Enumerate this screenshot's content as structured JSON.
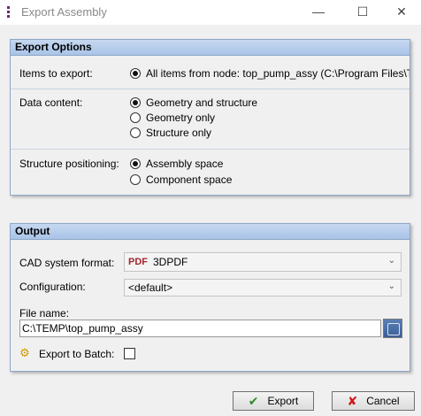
{
  "window": {
    "title": "Export Assembly",
    "minimize_glyph": "—",
    "maximize_glyph": "☐",
    "close_glyph": "✕"
  },
  "export_options": {
    "header": "Export Options",
    "items_to_export": {
      "label": "Items to export:",
      "option": "All items from node: top_pump_assy (C:\\Program Files\\T"
    },
    "data_content": {
      "label": "Data content:",
      "options": [
        "Geometry and structure",
        "Geometry only",
        "Structure only"
      ],
      "selected": "Geometry and structure"
    },
    "structure_positioning": {
      "label": "Structure positioning:",
      "options": [
        "Assembly space",
        "Component space"
      ],
      "selected": "Assembly space"
    }
  },
  "output": {
    "header": "Output",
    "cad_system_format": {
      "label": "CAD system format:",
      "badge": "PDF",
      "value": "3DPDF"
    },
    "configuration": {
      "label": "Configuration:",
      "value": "<default>"
    },
    "file_name": {
      "label": "File name:",
      "value": "C:\\TEMP\\top_pump_assy"
    },
    "export_to_batch": {
      "label": "Export to Batch:",
      "checked": false
    }
  },
  "buttons": {
    "export": "Export",
    "cancel": "Cancel"
  },
  "colors": {
    "group_header": "#b7cdeb",
    "group_border": "#8ea7c8",
    "export_check": "#2e8b2e",
    "cancel_x": "#d01818"
  }
}
